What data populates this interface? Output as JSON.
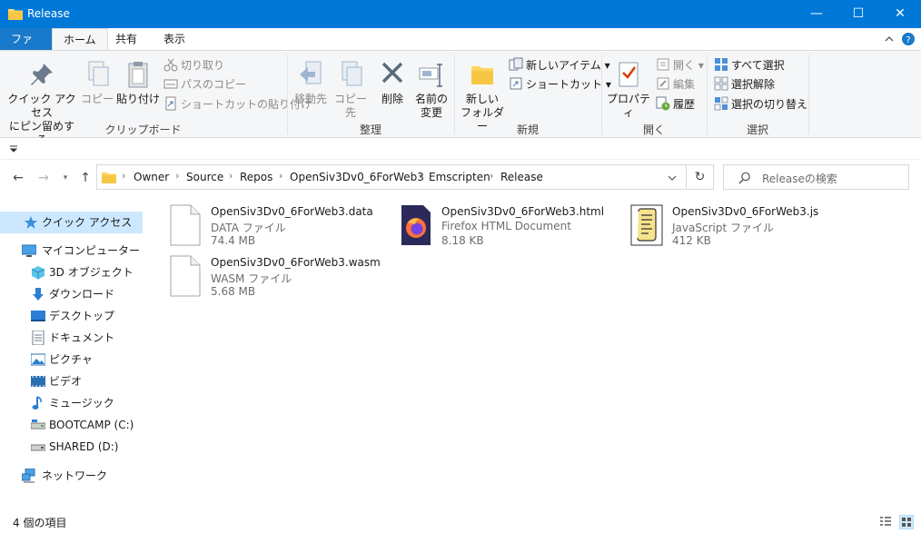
{
  "window": {
    "title": "Release",
    "minimize_glyph": "—",
    "maximize_glyph": "☐",
    "close_glyph": "✕"
  },
  "tabs": [
    {
      "label": "ファイル"
    },
    {
      "label": "ホーム"
    },
    {
      "label": "共有"
    },
    {
      "label": "表示"
    }
  ],
  "ribbon": {
    "clipboard": {
      "label": "クリップボード",
      "pin_label_1": "クイック アクセス",
      "pin_label_2": "にピン留めする",
      "copy": "コピー",
      "paste": "貼り付け",
      "cut": "切り取り",
      "copy_path": "パスのコピー",
      "paste_shortcut": "ショートカットの貼り付け"
    },
    "organize": {
      "label": "整理",
      "move_to": "移動先",
      "copy_to": "コピー先",
      "delete": "削除",
      "rename_1": "名前の",
      "rename_2": "変更"
    },
    "new": {
      "label": "新規",
      "new_folder_1": "新しい",
      "new_folder_2": "フォルダー",
      "new_item": "新しいアイテム",
      "shortcut": "ショートカット"
    },
    "open": {
      "label": "開く",
      "properties": "プロパティ",
      "open": "開く",
      "edit": "編集",
      "history": "履歴"
    },
    "select": {
      "label": "選択",
      "select_all": "すべて選択",
      "select_none": "選択解除",
      "invert": "選択の切り替え"
    }
  },
  "address": {
    "crumbs": [
      "Owner",
      "Source",
      "Repos",
      "OpenSiv3Dv0_6ForWeb3",
      "Emscripten",
      "Release"
    ],
    "search_placeholder": "Releaseの検索"
  },
  "nav_pane": {
    "quick_access": "クイック アクセス",
    "this_pc": "マイコンピューター",
    "objects3d": "3D オブジェクト",
    "downloads": "ダウンロード",
    "desktop": "デスクトップ",
    "documents": "ドキュメント",
    "pictures": "ピクチャ",
    "videos": "ビデオ",
    "music": "ミュージック",
    "drive_c": "BOOTCAMP (C:)",
    "drive_d": "SHARED (D:)",
    "network": "ネットワーク"
  },
  "files": [
    {
      "name": "OpenSiv3Dv0_6ForWeb3.data",
      "type": "DATA ファイル",
      "size": "74.4 MB",
      "icon": "blank-file-icon"
    },
    {
      "name": "OpenSiv3Dv0_6ForWeb3.html",
      "type": "Firefox HTML Document",
      "size": "8.18 KB",
      "icon": "firefox-icon"
    },
    {
      "name": "OpenSiv3Dv0_6ForWeb3.js",
      "type": "JavaScript ファイル",
      "size": "412 KB",
      "icon": "script-icon"
    },
    {
      "name": "OpenSiv3Dv0_6ForWeb3.wasm",
      "type": "WASM ファイル",
      "size": "5.68 MB",
      "icon": "blank-file-icon"
    }
  ],
  "status": {
    "item_count": "4 個の項目"
  },
  "colors": {
    "titlebar": "#0078d7",
    "file_tab": "#1979ca",
    "selection": "#cce8ff"
  }
}
